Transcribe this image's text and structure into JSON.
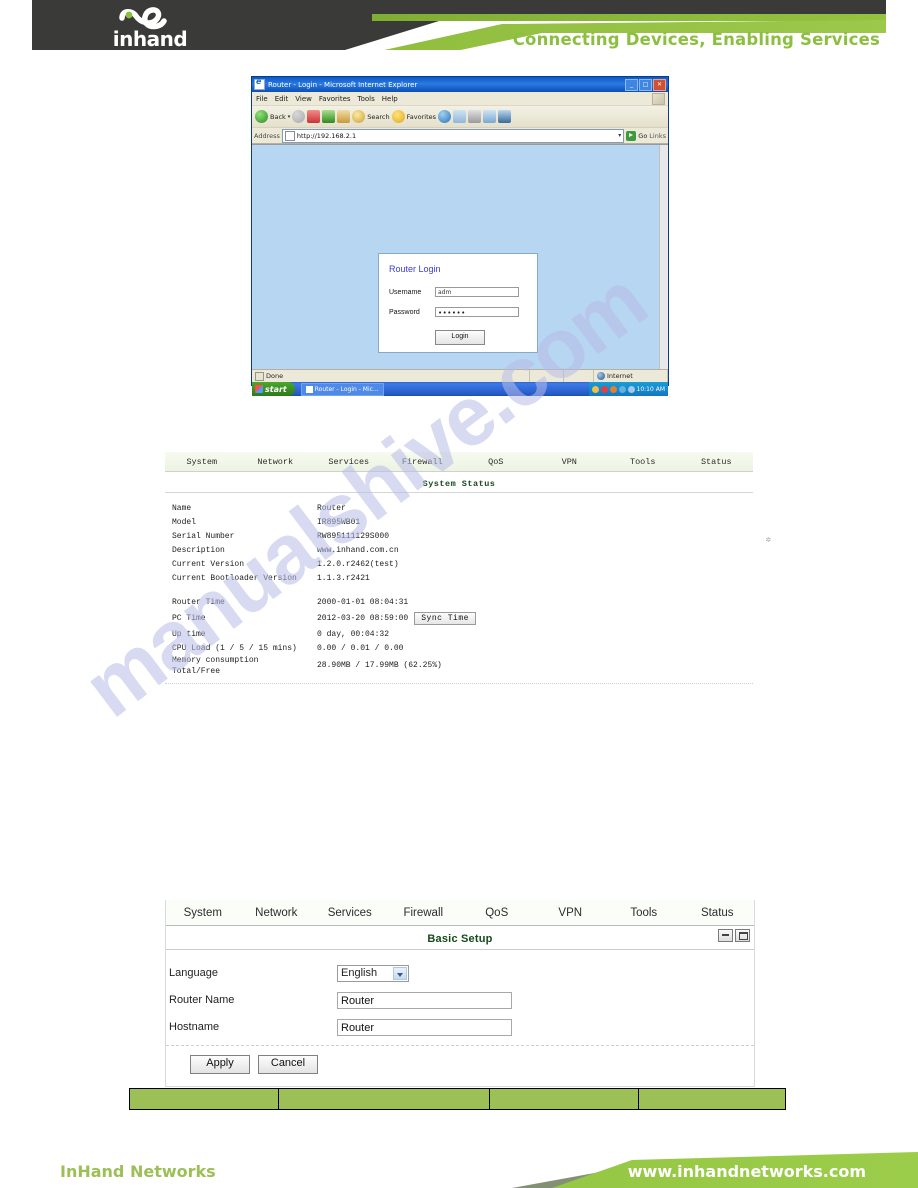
{
  "header": {
    "logo_text": "inhand",
    "tagline": "Connecting Devices, Enabling Services"
  },
  "watermark": {
    "text": "manualshive.com"
  },
  "browser": {
    "title": "Router - Login - Microsoft Internet Explorer",
    "menus": [
      "File",
      "Edit",
      "View",
      "Favorites",
      "Tools",
      "Help"
    ],
    "toolbar": [
      {
        "label": "Back",
        "icon": "back-arrow-icon"
      },
      {
        "label": "",
        "icon": "forward-arrow-icon"
      },
      {
        "label": "",
        "icon": "stop-icon"
      },
      {
        "label": "",
        "icon": "refresh-icon"
      },
      {
        "label": "",
        "icon": "home-icon"
      },
      {
        "label": "Search",
        "icon": "search-icon"
      },
      {
        "label": "Favorites",
        "icon": "favorites-star-icon"
      },
      {
        "label": "",
        "icon": "media-icon"
      },
      {
        "label": "",
        "icon": "history-icon"
      },
      {
        "label": "",
        "icon": "print-icon"
      },
      {
        "label": "",
        "icon": "edit-icon"
      },
      {
        "label": "",
        "icon": "messenger-icon"
      }
    ],
    "address_label": "Address",
    "address_value": "http://192.168.2.1",
    "go_label": "Go",
    "links_label": "Links",
    "window_buttons": {
      "minimize": "_",
      "maximize": "□",
      "close": "✕"
    },
    "status": {
      "left": "Done",
      "zone": "Internet"
    },
    "taskbar": {
      "start": "start",
      "task": "Router - Login - Mic...",
      "clock": "10:10 AM"
    }
  },
  "login": {
    "title": "Router Login",
    "username_label": "Username",
    "username_value": "adm",
    "password_label": "Password",
    "password_value": "••••••",
    "button_label": "Login"
  },
  "status_panel": {
    "tabs": [
      "System",
      "Network",
      "Services",
      "Firewall",
      "QoS",
      "VPN",
      "Tools",
      "Status"
    ],
    "title": "System Status",
    "rows_top": [
      {
        "key": "Name",
        "value": "Router"
      },
      {
        "key": "Model",
        "value": "IR895WB01"
      },
      {
        "key": "Serial Number",
        "value": "RW895111129S000"
      },
      {
        "key": "Description",
        "value": "www.inhand.com.cn"
      },
      {
        "key": "Current Version",
        "value": "1.2.0.r2462(test)"
      },
      {
        "key": "Current Bootloader Version",
        "value": "1.1.3.r2421"
      }
    ],
    "rows_bottom": [
      {
        "key": "Router Time",
        "value": "2000-01-01 08:04:31"
      },
      {
        "key": "PC Time",
        "value": "2012-03-20 08:59:00",
        "button": "Sync Time"
      },
      {
        "key": "Up time",
        "value": "0 day, 00:04:32"
      },
      {
        "key": "CPU Load (1 / 5 / 15 mins)",
        "value": "0.00 / 0.01 / 0.00"
      },
      {
        "key": "Memory consumption\nTotal/Free",
        "value": "28.90MB / 17.99MB (62.25%)"
      }
    ]
  },
  "setup_panel": {
    "tabs": [
      "System",
      "Network",
      "Services",
      "Firewall",
      "QoS",
      "VPN",
      "Tools",
      "Status"
    ],
    "title": "Basic Setup",
    "window_buttons": {
      "minimize": "minimize-icon",
      "restore": "restore-icon"
    },
    "fields": [
      {
        "label": "Language",
        "type": "select",
        "value": "English"
      },
      {
        "label": "Router Name",
        "type": "text",
        "value": "Router"
      },
      {
        "label": "Hostname",
        "type": "text",
        "value": "Router"
      }
    ],
    "apply_label": "Apply",
    "cancel_label": "Cancel"
  },
  "green_table": {
    "cells": [
      "",
      "",
      "",
      ""
    ]
  },
  "footer": {
    "company": "InHand Networks",
    "website": "www.inhandnetworks.com"
  },
  "colors": {
    "brand_green": "#8cbf3f",
    "dark_bar": "#3a3a38",
    "table_green": "#9cbf56",
    "link_blue": "#3b3bd4"
  }
}
